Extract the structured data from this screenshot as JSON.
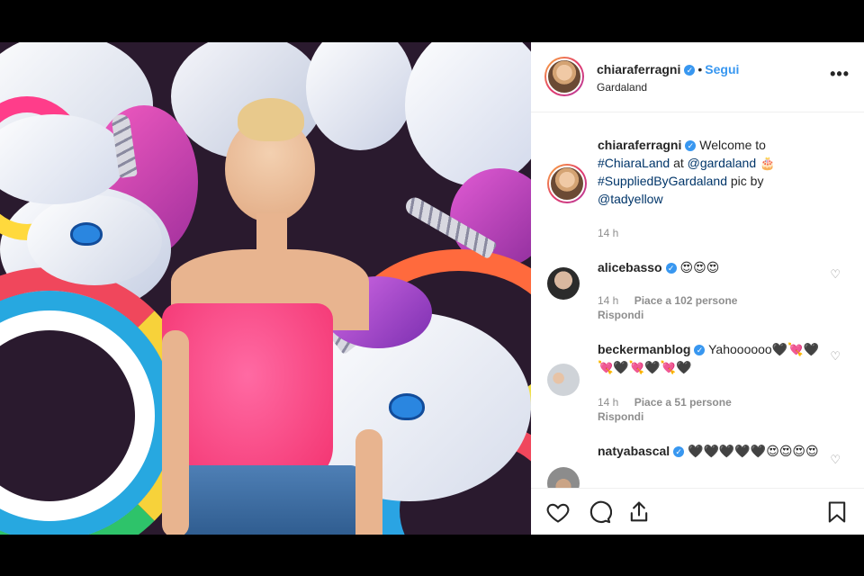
{
  "post": {
    "author": "chiaraferragni",
    "follow_label": "Segui",
    "location": "Gardaland",
    "more_icon": "more-horizontal-icon"
  },
  "caption": {
    "username": "chiaraferragni",
    "text_before": "Welcome to",
    "hashtag1": "#ChiaraLand",
    "text_at": "at",
    "mention1": "@gardaland",
    "emoji": "🎂",
    "hashtag2": "#SuppliedByGardaland",
    "text_pic": "pic by",
    "mention2": "@tadyellow",
    "time": "14 h"
  },
  "comments": [
    {
      "username": "alicebasso",
      "text": "😍😍😍",
      "time": "14 h",
      "likes": "Piace a 102 persone",
      "reply": "Rispondi"
    },
    {
      "username": "beckermanblog",
      "text": "Yahoooooo🖤💘🖤💘🖤💘🖤💘🖤",
      "time": "14 h",
      "likes": "Piace a 51 persone",
      "reply": "Rispondi"
    },
    {
      "username": "natyabascal",
      "text": "🖤🖤🖤🖤🖤😍😍😍😍"
    }
  ],
  "icons": {
    "like": "heart-icon",
    "comment": "comment-icon",
    "share": "share-icon",
    "save": "bookmark-icon"
  },
  "colors": {
    "accent": "#3897f0",
    "text": "#262626",
    "muted": "#8e8e8e"
  }
}
